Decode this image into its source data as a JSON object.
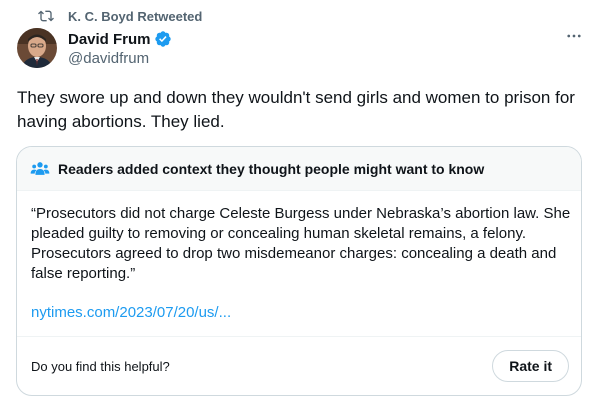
{
  "retweet": {
    "label": "K. C. Boyd Retweeted"
  },
  "author": {
    "display_name": "David Frum",
    "handle": "@davidfrum",
    "verified": true
  },
  "tweet": {
    "text": "They swore up and down they wouldn't send girls and women to prison for having abortions. They lied."
  },
  "community_note": {
    "title": "Readers added context they thought people might want to know",
    "body": "“Prosecutors did not charge Celeste Burgess under Nebraska’s abortion law. She pleaded guilty to removing or concealing human skeletal remains, a felony. Prosecutors agreed to drop two misdemeanor charges: concealing a death and false reporting.”",
    "link_text": "nytimes.com/2023/07/20/us/...",
    "helpful_question": "Do you find this helpful?",
    "rate_button_label": "Rate it"
  },
  "icons": {
    "retweet": "retweet-icon",
    "verified": "verified-badge-icon",
    "more": "more-options-icon",
    "people": "people-icon"
  },
  "colors": {
    "accent": "#1d9bf0",
    "secondary_text": "#536471",
    "border": "#cfd9de",
    "note_header_bg": "#f7f9f9"
  }
}
